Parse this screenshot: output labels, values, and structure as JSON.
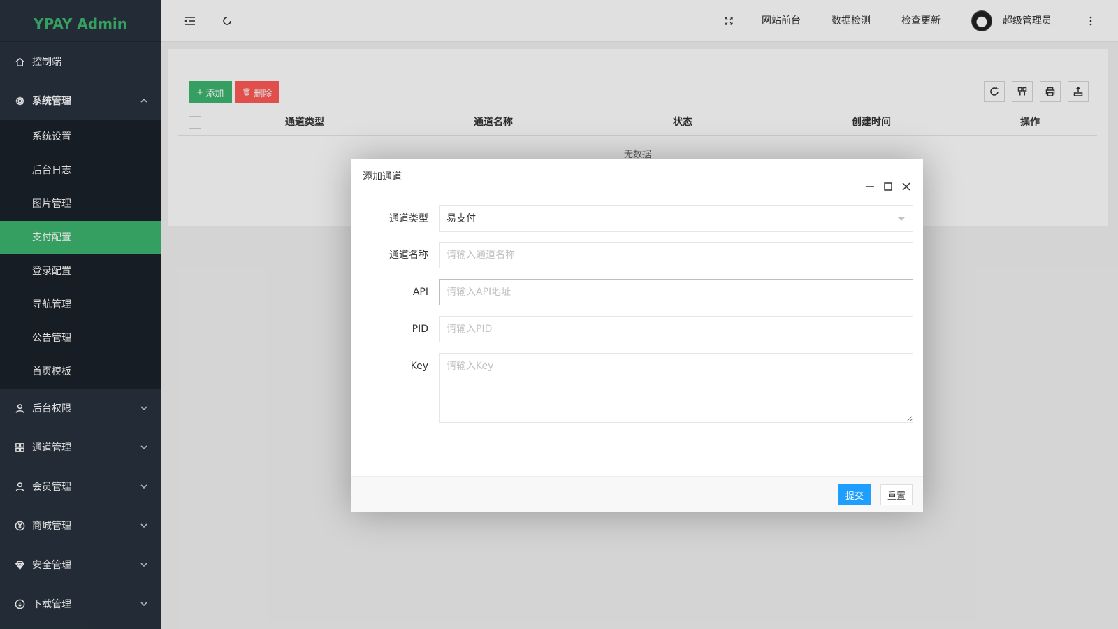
{
  "sidebar": {
    "logo": "YPAY Admin",
    "items": [
      {
        "label": "控制端",
        "icon": "home-icon"
      },
      {
        "label": "系统管理",
        "icon": "gear-icon",
        "open": true,
        "children": [
          "系统设置",
          "后台日志",
          "图片管理",
          "支付配置",
          "登录配置",
          "导航管理",
          "公告管理",
          "首页模板"
        ],
        "active_child": "支付配置"
      },
      {
        "label": "后台权限",
        "icon": "user-icon"
      },
      {
        "label": "通道管理",
        "icon": "apps-icon"
      },
      {
        "label": "会员管理",
        "icon": "user-icon"
      },
      {
        "label": "商城管理",
        "icon": "yen-icon"
      },
      {
        "label": "安全管理",
        "icon": "diamond-icon"
      },
      {
        "label": "下载管理",
        "icon": "download-icon"
      }
    ]
  },
  "header": {
    "links": [
      "网站前台",
      "数据检测",
      "检查更新"
    ],
    "username": "超级管理员"
  },
  "toolbar": {
    "add_label": "添加",
    "delete_label": "删除"
  },
  "table": {
    "columns": [
      "通道类型",
      "通道名称",
      "状态",
      "创建时间",
      "操作"
    ],
    "empty_text": "无数据"
  },
  "modal": {
    "title": "添加通道",
    "fields": {
      "type_label": "通道类型",
      "type_value": "易支付",
      "name_label": "通道名称",
      "name_placeholder": "请输入通道名称",
      "api_label": "API",
      "api_placeholder": "请输入API地址",
      "pid_label": "PID",
      "pid_placeholder": "请输入PID",
      "key_label": "Key",
      "key_placeholder": "请输入Key"
    },
    "submit_label": "提交",
    "reset_label": "重置"
  },
  "colors": {
    "sidebar_bg": "#28333e",
    "submenu_bg": "#1b2129",
    "accent_green": "#3cb56f",
    "danger_red": "#ff5a57",
    "primary_blue": "#1e9fff"
  }
}
